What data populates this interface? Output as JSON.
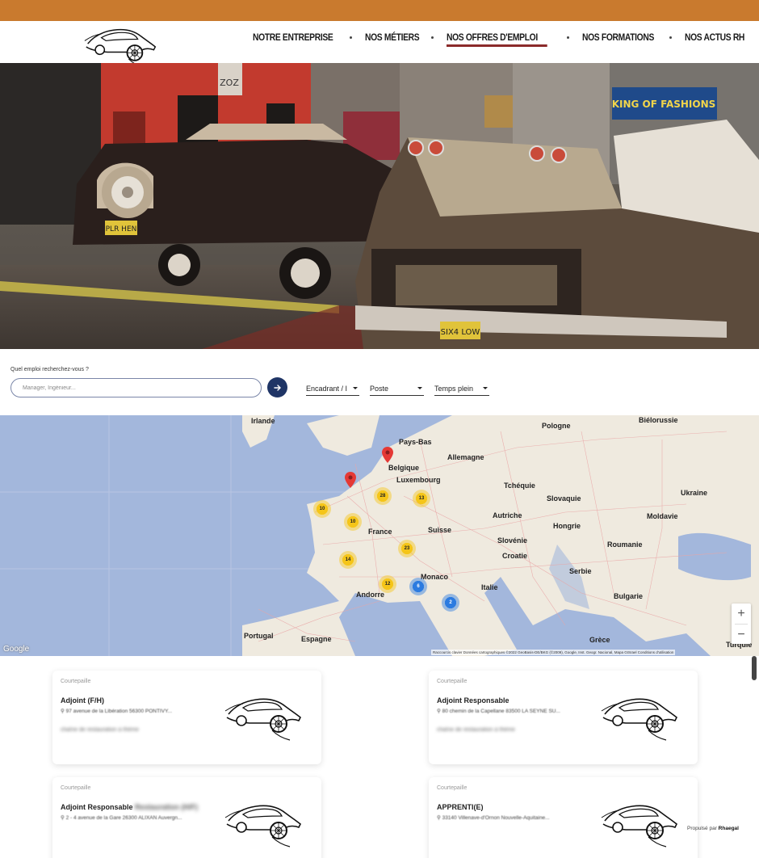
{
  "nav": {
    "items": [
      {
        "label": "NOTRE ENTREPRISE",
        "active": false
      },
      {
        "label": "NOS MÉTIERS",
        "active": false
      },
      {
        "label": "NOS OFFRES D'EMPLOI",
        "active": true
      },
      {
        "label": "NOS FORMATIONS",
        "active": false
      },
      {
        "label": "NOS ACTUS RH",
        "active": false
      }
    ]
  },
  "hero": {
    "plates": [
      "PLR HEN",
      "SIX4 LOW"
    ],
    "signs": [
      "KING OF FASHIONS",
      "ZOZ"
    ]
  },
  "search": {
    "label": "Quel emploi recherchez-vous ?",
    "placeholder": "Manager, Ingénieur...",
    "filters": [
      "Encadrant / I",
      "Poste",
      "Temps plein"
    ]
  },
  "map": {
    "countries": [
      "Irlande",
      "Pays-Bas",
      "Pologne",
      "Biélorussie",
      "Belgique",
      "Allemagne",
      "Luxembourg",
      "Tchéquie",
      "Ukraine",
      "Slovaquie",
      "Autriche",
      "Hongrie",
      "Moldavie",
      "France",
      "Suisse",
      "Slovénie",
      "Roumanie",
      "Croatie",
      "Serbie",
      "Monaco",
      "Italie",
      "Andorre",
      "Bulgarie",
      "Portugal",
      "Espagne",
      "Grèce",
      "Turquie"
    ],
    "clusters": [
      {
        "count": "10",
        "color": "yellow"
      },
      {
        "count": "28",
        "color": "yellow"
      },
      {
        "count": "13",
        "color": "yellow"
      },
      {
        "count": "10",
        "color": "yellow"
      },
      {
        "count": "23",
        "color": "yellow"
      },
      {
        "count": "14",
        "color": "yellow"
      },
      {
        "count": "12",
        "color": "yellow"
      },
      {
        "count": "6",
        "color": "blue"
      },
      {
        "count": "2",
        "color": "blue"
      }
    ],
    "zoom_in": "+",
    "zoom_out": "−",
    "google": "Google",
    "attribution": "Raccourcis clavier   Données cartographiques ©2022 GeoBasis-DE/BKG (©2009), Google, Inst. Geogr. Nacional, Mapa GISrael   Conditions d'utilisation"
  },
  "jobs": [
    {
      "company": "Courtepaille",
      "title": "Adjoint (F/H)",
      "title_blur": "",
      "address": "97 avenue de la Libération 56300 PONTIVY...",
      "description": "chaîne de restauration à thème"
    },
    {
      "company": "Courtepaille",
      "title": "Adjoint Responsable",
      "title_blur": "",
      "address": "80 chemin de la Capellane 83500 LA SEYNE SU...",
      "description": "chaîne de restauration à thème"
    },
    {
      "company": "Courtepaille",
      "title": "Adjoint Responsable ",
      "title_blur": "Restauration (H/F)",
      "address": "2 - 4 avenue de la Gare 26300 ALIXAN Auvergn...",
      "description": ""
    },
    {
      "company": "Courtepaille",
      "title": "APPRENTI(E)",
      "title_blur": "",
      "address": "33140 Villenave-d'Ornon Nouvelle-Aquitaine...",
      "description": ""
    }
  ],
  "footer": {
    "powered_prefix": "Propulsé par ",
    "powered_brand": "Rhaegal"
  },
  "colors": {
    "topbar": "#c97a2e",
    "nav_active_underline": "#8b2a2a",
    "search_button": "#1f3566",
    "cluster_yellow": "#f5c518",
    "cluster_blue": "#2c7be0",
    "marker": "#e53935"
  }
}
